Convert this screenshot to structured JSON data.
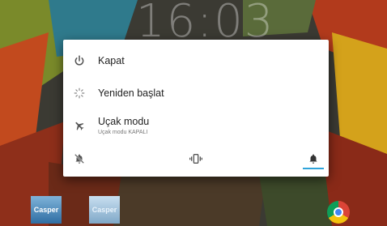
{
  "lockscreen": {
    "clock": "16:03"
  },
  "power_menu": {
    "items": [
      {
        "label": "Kapat",
        "icon": "power-icon"
      },
      {
        "label": "Yeniden başlat",
        "icon": "restart-icon"
      },
      {
        "label": "Uçak modu",
        "sublabel": "Uçak modu KAPALI",
        "icon": "airplane-icon"
      }
    ],
    "sound_modes": [
      {
        "icon": "silent-bell-icon",
        "selected": false
      },
      {
        "icon": "vibrate-icon",
        "selected": false
      },
      {
        "icon": "bell-icon",
        "selected": true
      }
    ],
    "accent_color": "#30a4da"
  },
  "home_apps": [
    {
      "label": "Casper"
    },
    {
      "label": "Casper"
    },
    {
      "label": "",
      "icon": "chrome-icon"
    }
  ]
}
